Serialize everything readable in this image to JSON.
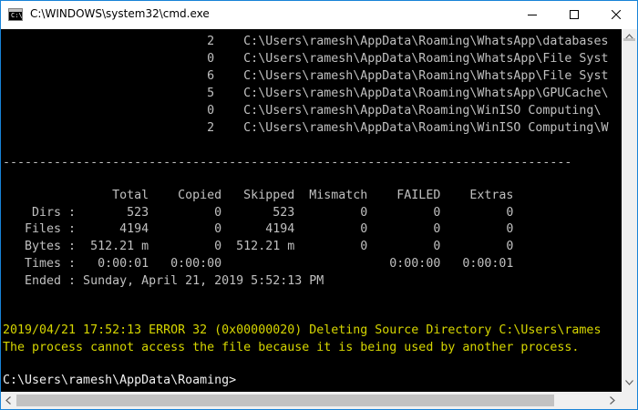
{
  "window": {
    "title": "C:\\WINDOWS\\system32\\cmd.exe",
    "icon_text": "C:\\",
    "accent": "#1883d7"
  },
  "console": {
    "background": "#000000",
    "text_color": "#c0c0c0",
    "warning_color": "#d6d600",
    "lines": [
      "                            2    C:\\Users\\ramesh\\AppData\\Roaming\\WhatsApp\\databases",
      "                            0    C:\\Users\\ramesh\\AppData\\Roaming\\WhatsApp\\File Syst",
      "                            6    C:\\Users\\ramesh\\AppData\\Roaming\\WhatsApp\\File Syst",
      "                            5    C:\\Users\\ramesh\\AppData\\Roaming\\WhatsApp\\GPUCache\\",
      "                            0    C:\\Users\\ramesh\\AppData\\Roaming\\WinISO Computing\\",
      "                            2    C:\\Users\\ramesh\\AppData\\Roaming\\WinISO Computing\\W",
      "",
      "",
      "------------------------------------------------------------------------------",
      "",
      "               Total    Copied   Skipped  Mismatch    FAILED    Extras",
      "    Dirs :       523         0       523         0         0         0",
      "   Files :      4194         0      4194         0         0         0",
      "   Bytes :  512.21 m         0  512.21 m         0         0         0",
      "   Times :   0:00:01   0:00:00                       0:00:00   0:00:01",
      "   Ended : Sunday, April 21, 2019 5:52:13 PM",
      "",
      "",
      "2019/04/21 17:52:13 ERROR 32 (0x00000020) Deleting Source Directory C:\\Users\\rames",
      "The process cannot access the file because it is being used by another process.",
      "",
      "C:\\Users\\ramesh\\AppData\\Roaming>"
    ]
  }
}
